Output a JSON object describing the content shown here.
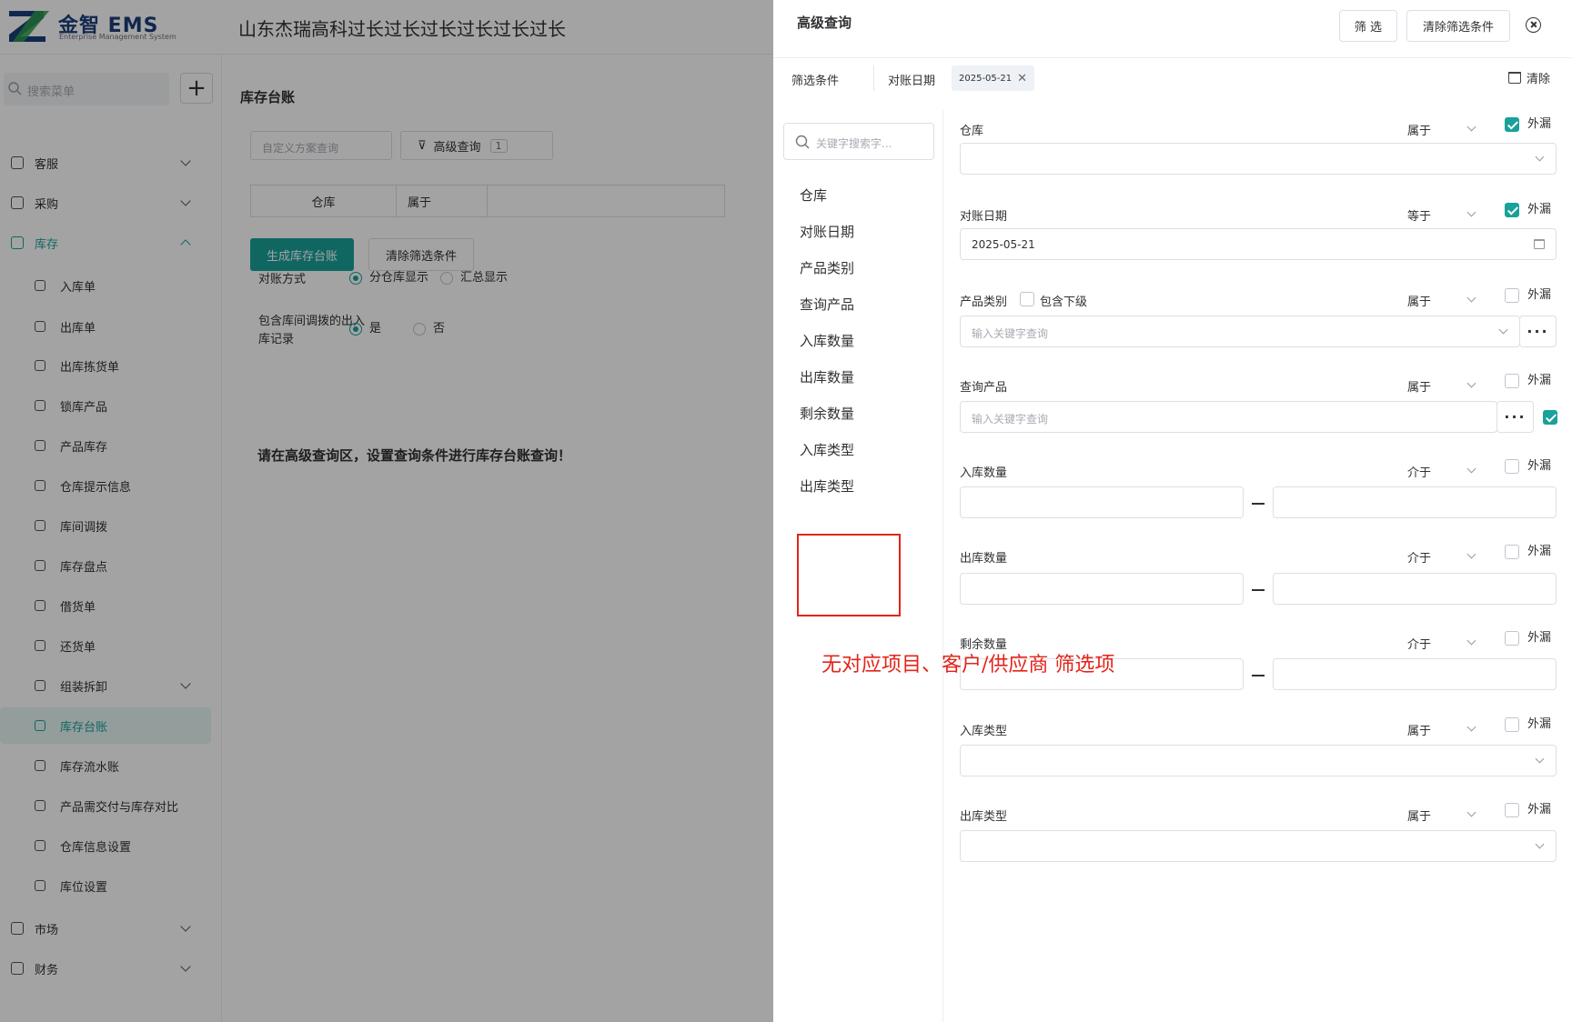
{
  "app": {
    "brand": "金智 EMS",
    "brand_sub": "Enterprise Management System",
    "company": "山东杰瑞高科过长过长过长过长过长过长"
  },
  "sidebar": {
    "search_placeholder": "搜索菜单",
    "groups_top": [
      {
        "label": "客服"
      },
      {
        "label": "采购"
      },
      {
        "label": "库存"
      }
    ],
    "inventory_items": [
      {
        "label": "入库单"
      },
      {
        "label": "出库单"
      },
      {
        "label": "出库拣货单"
      },
      {
        "label": "锁库产品"
      },
      {
        "label": "产品库存"
      },
      {
        "label": "仓库提示信息"
      },
      {
        "label": "库间调拨"
      },
      {
        "label": "库存盘点"
      },
      {
        "label": "借货单"
      },
      {
        "label": "还货单"
      },
      {
        "label": "组装拆卸"
      },
      {
        "label": "库存台账"
      },
      {
        "label": "库存流水账"
      },
      {
        "label": "产品需交付与库存对比"
      },
      {
        "label": "仓库信息设置"
      },
      {
        "label": "库位设置"
      }
    ],
    "groups_bottom": [
      {
        "label": "市场"
      },
      {
        "label": "财务"
      }
    ]
  },
  "page": {
    "title": "库存台账",
    "scheme_placeholder": "自定义方案查询",
    "advanced_label": "高级查询",
    "advanced_count": "1",
    "filter_field": "仓库",
    "filter_op": "属于",
    "generate_label": "生成库存台账",
    "clear_label": "清除筛选条件",
    "recon_label": "对账方式",
    "recon_opt1": "分仓库显示",
    "recon_opt2": "汇总显示",
    "transfer_label": "包含库间调拨的出入库记录",
    "yes": "是",
    "no": "否",
    "hint": "请在高级查询区，设置查询条件进行库存台账查询！"
  },
  "drawer": {
    "title": "高级查询",
    "filter_btn": "筛 选",
    "clear_btn": "清除筛选条件",
    "conditions_label": "筛选条件",
    "condition_field": "对账日期",
    "condition_value": "2025-05-21",
    "clear_all": "清除",
    "keyword_placeholder": "关键字搜索字...",
    "field_list": [
      "仓库",
      "对账日期",
      "产品类别",
      "查询产品",
      "入库数量",
      "出库数量",
      "剩余数量",
      "入库类型",
      "出库类型"
    ],
    "ext_label": "外漏",
    "fields": {
      "warehouse": {
        "label": "仓库",
        "op": "属于"
      },
      "date": {
        "label": "对账日期",
        "op": "等于",
        "value": "2025-05-21"
      },
      "category": {
        "label": "产品类别",
        "sub_label": "包含下级",
        "op": "属于",
        "placeholder": "输入关键字查询"
      },
      "product": {
        "label": "查询产品",
        "op": "属于",
        "placeholder": "输入关键字查询"
      },
      "in_qty": {
        "label": "入库数量",
        "op": "介于"
      },
      "out_qty": {
        "label": "出库数量",
        "op": "介于"
      },
      "remain_qty": {
        "label": "剩余数量",
        "op": "介于"
      },
      "in_type": {
        "label": "入库类型",
        "op": "属于"
      },
      "out_type": {
        "label": "出库类型",
        "op": "属于"
      }
    },
    "dots": "···"
  },
  "annotation": {
    "note": "无对应项目、客户/供应商 筛选项",
    "color": "#e3241a"
  },
  "colors": {
    "accent": "#19a19a"
  }
}
